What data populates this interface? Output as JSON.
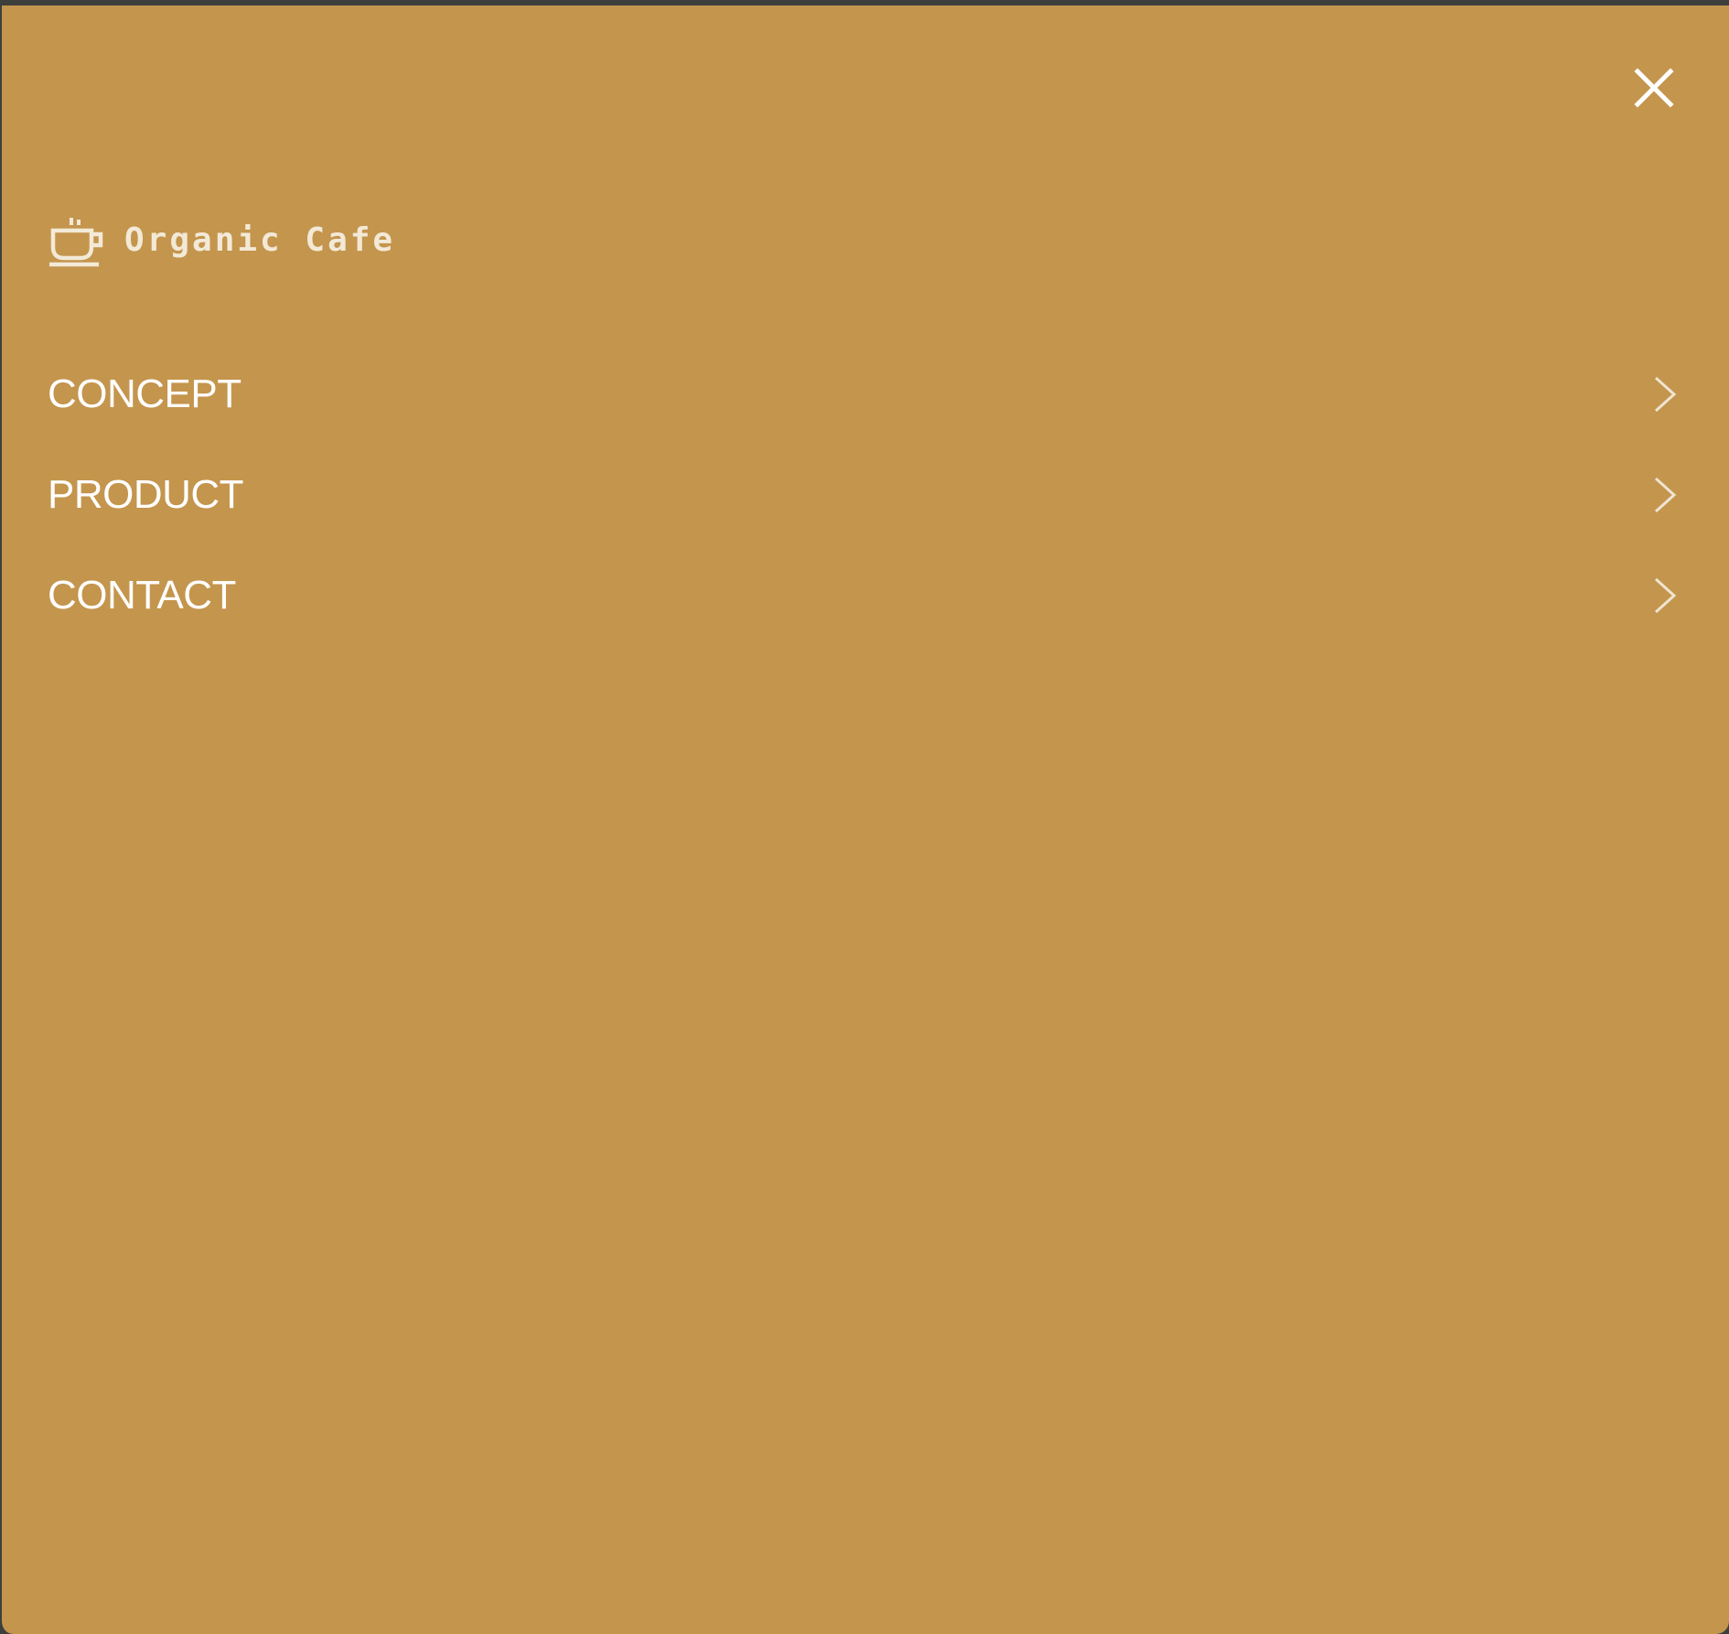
{
  "menu": {
    "background_color": "#c4954d",
    "close_icon": "close-icon",
    "brand": {
      "icon": "coffee-cup-icon",
      "name": "Organic Cafe"
    },
    "items": [
      {
        "label": "CONCEPT",
        "icon": "chevron-right-icon"
      },
      {
        "label": "PRODUCT",
        "icon": "chevron-right-icon"
      },
      {
        "label": "CONTACT",
        "icon": "chevron-right-icon"
      }
    ]
  }
}
